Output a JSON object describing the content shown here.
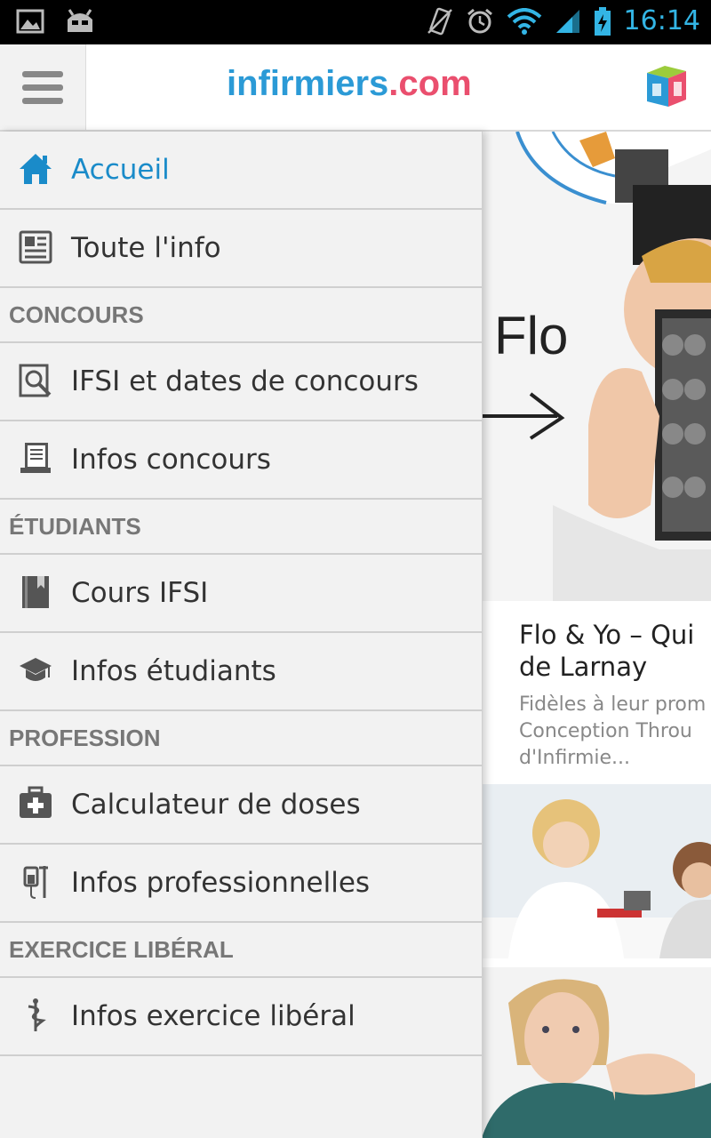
{
  "status_bar": {
    "time": "16:14",
    "icons": [
      "image-icon",
      "android-icon",
      "vibrate-icon",
      "alarm-icon",
      "wifi-icon",
      "signal-icon",
      "battery-icon"
    ]
  },
  "action_bar": {
    "logo_part1": "infirmiers",
    "logo_part2": ".com",
    "brand_blue": "#2b9ad6",
    "brand_pink": "#ea4f6e"
  },
  "drawer": {
    "accueil": "Accueil",
    "toute_info": "Toute l'info",
    "section_concours": "CONCOURS",
    "ifsi_dates": "IFSI et dates de concours",
    "infos_concours": "Infos concours",
    "section_etudiants": "ÉTUDIANTS",
    "cours_ifsi": "Cours IFSI",
    "infos_etudiants": "Infos étudiants",
    "section_profession": "PROFESSION",
    "calculateur": "Calculateur de doses",
    "infos_pro": "Infos professionnelles",
    "section_liberal": "EXERCICE LIBÉRAL",
    "infos_liberal": "Infos exercice libéral",
    "active_color": "#1a8bc9"
  },
  "content": {
    "card1": {
      "img_text": "Flo",
      "title_line1": "Flo & Yo – Qui",
      "title_line2": "de Larnay",
      "desc_line1": "Fidèles à leur prom",
      "desc_line2": "Conception Throu",
      "desc_line3": "d'Infirmie..."
    }
  }
}
